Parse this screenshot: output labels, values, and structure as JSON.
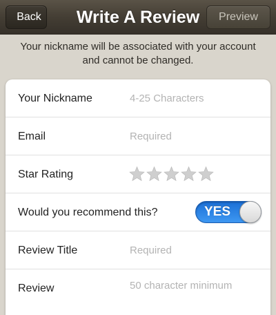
{
  "navbar": {
    "title": "Write A Review",
    "back_label": "Back",
    "preview_label": "Preview"
  },
  "notice": {
    "line1": "Your nickname will be associated with your account",
    "line2": "and cannot be changed."
  },
  "form": {
    "nickname": {
      "label": "Your Nickname",
      "placeholder": "4-25 Characters"
    },
    "email": {
      "label": "Email",
      "placeholder": "Required"
    },
    "star_rating": {
      "label": "Star Rating",
      "max_stars": 5,
      "value": 0,
      "empty_color": "#cfcfcf"
    },
    "recommend": {
      "label": "Would you recommend this?",
      "toggle_label": "YES",
      "on": true,
      "color": "#2a82e4"
    },
    "review_title": {
      "label": "Review Title",
      "placeholder": "Required"
    },
    "review": {
      "label": "Review",
      "placeholder": "50 character minimum"
    }
  }
}
